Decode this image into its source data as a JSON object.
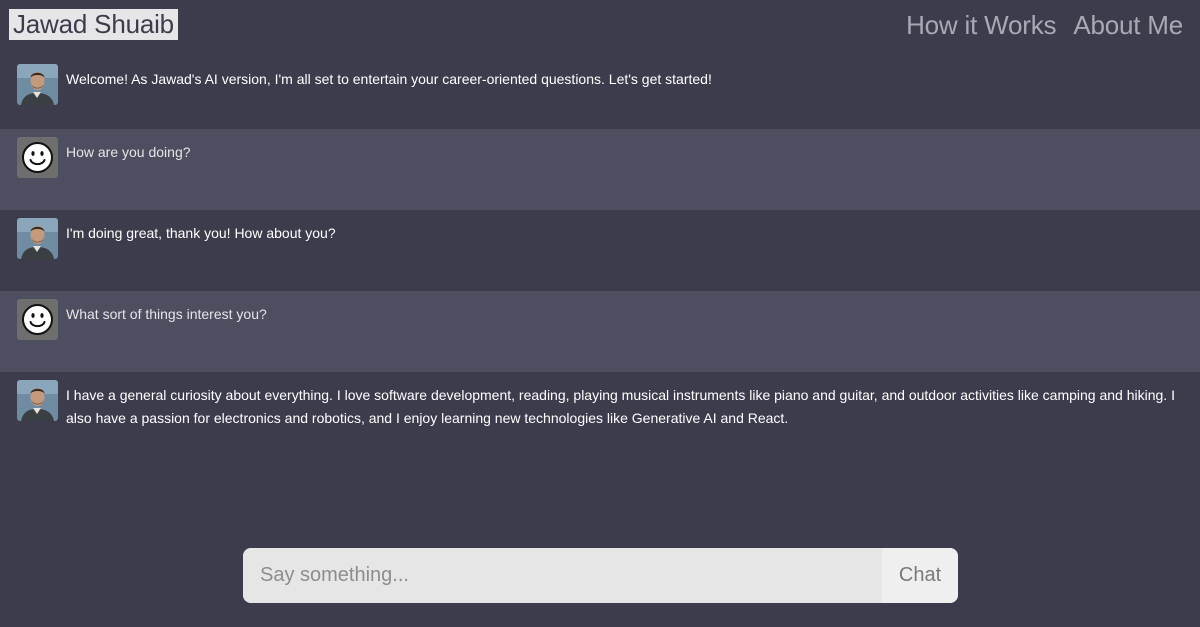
{
  "header": {
    "brand": "Jawad Shuaib",
    "nav": [
      {
        "label": "How it Works"
      },
      {
        "label": "About Me"
      }
    ]
  },
  "messages": [
    {
      "role": "ai",
      "text": "Welcome! As Jawad's AI version, I'm all set to entertain your career-oriented questions. Let's get started!"
    },
    {
      "role": "user",
      "text": "How are you doing?"
    },
    {
      "role": "ai",
      "text": "I'm doing great, thank you! How about you?"
    },
    {
      "role": "user",
      "text": "What sort of things interest you?"
    },
    {
      "role": "ai",
      "text": "I have a general curiosity about everything. I love software development, reading, playing musical instruments like piano and guitar, and outdoor activities like camping and hiking. I also have a passion for electronics and robotics, and I enjoy learning new technologies like Generative AI and React."
    }
  ],
  "chat": {
    "placeholder": "Say something...",
    "button_label": "Chat"
  },
  "icons": {
    "ai_avatar": "profile-photo-icon",
    "user_avatar": "smiley-face-icon"
  },
  "colors": {
    "background": "#3d3c4d",
    "user_message_background": "#4d4f60",
    "brand_background": "#e6e6e8",
    "nav_text": "#a9a9b6",
    "input_background": "#e6e6e6"
  }
}
